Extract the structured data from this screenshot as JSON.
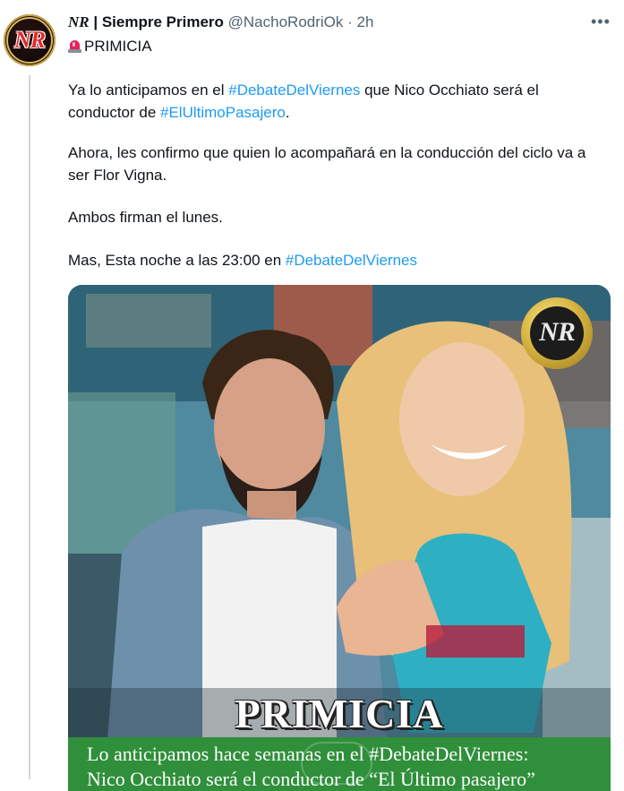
{
  "tweet": {
    "avatar_initials": "NR",
    "author_prefix": "NR",
    "author_name": "| Siempre Primero",
    "handle": "@NachoRodriOk",
    "separator": "·",
    "time": "2h",
    "headline": "PRIMICIA",
    "headline_emoji": "rotating-light-icon",
    "paragraphs": [
      {
        "parts": [
          {
            "t": "Ya lo anticipamos en el "
          },
          {
            "t": "#DebateDelViernes",
            "tag": true
          },
          {
            "t": " que Nico Occhiato será el conductor de "
          },
          {
            "t": "#ElUltimoPasajero",
            "tag": true
          },
          {
            "t": "."
          }
        ]
      },
      {
        "parts": [
          {
            "t": "Ahora, les confirmo que quien lo acompañará en la conducción del ciclo va a ser Flor Vigna."
          }
        ]
      },
      {
        "parts": [
          {
            "t": "Ambos firman el lunes."
          }
        ]
      },
      {
        "parts": [
          {
            "t": "Mas, Esta noche a las 23:00 en "
          },
          {
            "t": "#DebateDelViernes",
            "tag": true
          }
        ]
      }
    ]
  },
  "image": {
    "watermark_initials": "NR",
    "title": "PRIMICIA",
    "caption_line1": "Lo anticipamos hace semanas en el #DebateDelViernes:",
    "caption_line2": "Nico Occhiato será el conductor de “El Último pasajero”"
  },
  "colors": {
    "link": "#1d9bf0",
    "text": "#0f1419",
    "meta": "#536471",
    "band": "#2f8f3a"
  }
}
